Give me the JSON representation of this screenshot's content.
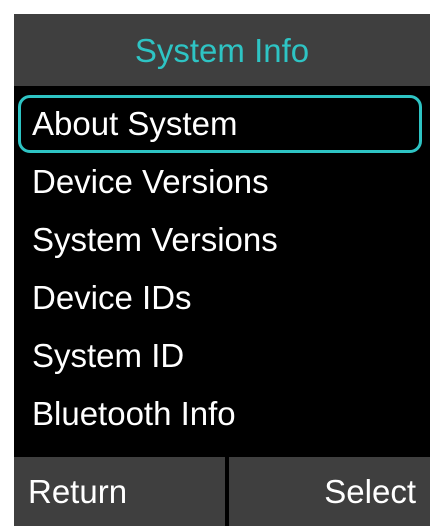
{
  "header": {
    "title": "System Info"
  },
  "menu": {
    "items": [
      {
        "label": "About System",
        "selected": true
      },
      {
        "label": "Device Versions",
        "selected": false
      },
      {
        "label": "System Versions",
        "selected": false
      },
      {
        "label": "Device IDs",
        "selected": false
      },
      {
        "label": "System ID",
        "selected": false
      },
      {
        "label": "Bluetooth Info",
        "selected": false
      }
    ]
  },
  "softkeys": {
    "left_label": "Return",
    "right_label": "Select"
  },
  "colors": {
    "accent": "#2ec4c4",
    "bar_bg": "#3f3f3f",
    "screen_bg": "#000000",
    "text": "#ffffff"
  }
}
